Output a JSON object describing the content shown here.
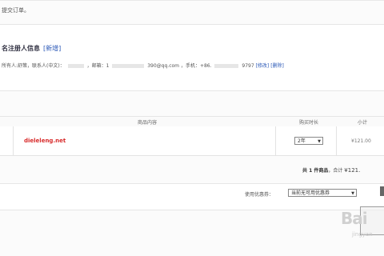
{
  "notice_text": "提交订单。",
  "registrant": {
    "title": "名注册人信息",
    "new_link": "[新增]",
    "owner_prefix": "所有人:舒策，联系人(中文)：",
    "email_label": "，邮箱：1",
    "email_tail": "390@qq.com",
    "phone_label": "，手机：+86.",
    "phone_tail": "9797",
    "edit_link": "[修改]",
    "delete_link": "[删除]"
  },
  "table": {
    "headers": {
      "content": "商品内容",
      "duration": "购买时长",
      "subtotal": "小计"
    },
    "rows": [
      {
        "domain": "dieleleng.net",
        "duration": "2年",
        "price": "¥121.00"
      }
    ]
  },
  "summary": {
    "count_text": "共 1 件商品",
    "total_label": "，合计",
    "total_amount": "¥121."
  },
  "coupon": {
    "label": "使用优惠券：",
    "selected": "当前无可用优惠券"
  },
  "watermark": {
    "text": "Bai",
    "sub": "jingyan"
  }
}
